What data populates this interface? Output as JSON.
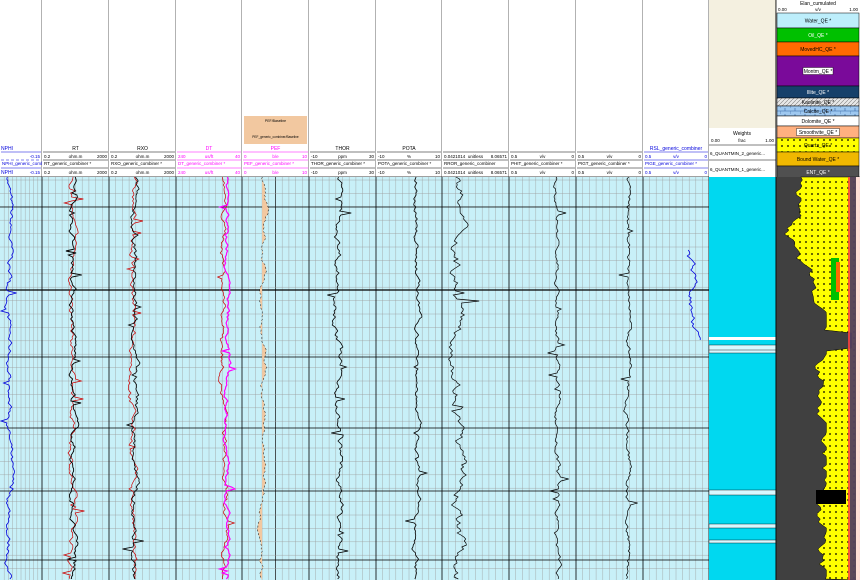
{
  "colors": {
    "plot_bg": "#c8f0f8",
    "grid_major": "#000000",
    "grid_minor": "#9a9a9a",
    "nphi": "#0000dd",
    "dt": "#ff00ff",
    "red_curve": "#cc0000",
    "pef_fill": "#f2c8a0",
    "sat_bg": "#00d8f0",
    "yellow": "#ffff00",
    "green": "#00c000",
    "orange": "#ff6a00",
    "purple": "#7a0a9a",
    "grey": "#404040",
    "navy": "#16406a",
    "pink": "#ff4040"
  },
  "tracks": [
    {
      "id": "nphi",
      "title": "",
      "cname": "NPHI_generic_combiner *",
      "unit": "",
      "left": "",
      "right": "-0.15",
      "color": "#0000dd",
      "name_top": "NPHI",
      "name_bottom": "NPHI"
    },
    {
      "id": "rt",
      "title": "RT",
      "cname": "RT_generic_combiner *",
      "unit": "ohm.m",
      "left": "0.2",
      "right": "2000",
      "color": "#000000",
      "name_top": "",
      "name_bottom": ""
    },
    {
      "id": "rxo",
      "title": "RXO",
      "cname": "RXO_generic_combiner *",
      "unit": "ohm.m",
      "left": "0.2",
      "right": "2000",
      "color": "#000000",
      "name_top": "",
      "name_bottom": ""
    },
    {
      "id": "dt",
      "title": "DT",
      "cname": "DT_generic_combiner *",
      "unit": "us/ft",
      "left": "240",
      "right": "40",
      "color": "#ff00ff",
      "name_top": "",
      "name_bottom": ""
    },
    {
      "id": "pef",
      "title": "PEF",
      "cname": "PEF_generic_combiner *",
      "unit": "b/e",
      "left": "0",
      "right": "10",
      "color": "#ff00ff",
      "name_top": "",
      "name_bottom": ""
    },
    {
      "id": "thor",
      "title": "THOR",
      "cname": "THOR_generic_combiner *",
      "unit": "ppm",
      "left": "-10",
      "right": "30",
      "color": "#000000",
      "name_top": "",
      "name_bottom": ""
    },
    {
      "id": "pota",
      "title": "POTA",
      "cname": "POTA_generic_combiner *",
      "unit": "%",
      "left": "-10",
      "right": "10",
      "color": "#000000",
      "name_top": "",
      "name_bottom": ""
    },
    {
      "id": "rror",
      "title": "",
      "cname": "RROR_generic_combiner",
      "unit": "unitless",
      "left": "0.0421014",
      "right": "8.06571",
      "color": "#000000",
      "name_top": "",
      "name_bottom": ""
    },
    {
      "id": "phit",
      "title": "",
      "cname": "PHIT_generic_combiner *",
      "unit": "v/v",
      "left": "0.5",
      "right": "0",
      "color": "#000000",
      "name_top": "",
      "name_bottom": ""
    },
    {
      "id": "pigt",
      "title": "",
      "cname": "PIGT_generic_combiner *",
      "unit": "v/v",
      "left": "0.5",
      "right": "0",
      "color": "#000000",
      "name_top": "",
      "name_bottom": ""
    },
    {
      "id": "pige",
      "title": "RSL_generic_combiner",
      "cname": "PIGE_generic_combiner *",
      "unit": "v/v",
      "left": "0.5",
      "right": "0",
      "color": "#0000dd",
      "name_top": "",
      "name_bottom": ""
    }
  ],
  "pef_legend": {
    "line1": "PEF/Baseline",
    "line2": "PEF_generic_combiner/Baseline"
  },
  "weights": {
    "title": "Weights",
    "left": "0.00",
    "unit": "frac",
    "right": "1.00"
  },
  "quantmin": [
    "6_QUANTMIN_2_generic...",
    "6_QUANTMIN_1_generic..."
  ],
  "elan": {
    "title": "Elan_cumulated",
    "left": "0.00",
    "unit": "v/v",
    "right": "1.00"
  },
  "legend": [
    {
      "label": "Water_QE *",
      "bg": "#bdeefb",
      "fg": "#000000",
      "sel": false
    },
    {
      "label": "Oil_QE *",
      "bg": "#00c000",
      "fg": "#ffffff",
      "sel": false
    },
    {
      "label": "MovedHC_QE *",
      "bg": "#ff6a00",
      "fg": "#000000",
      "sel": false
    },
    {
      "label": "Montm_QE *",
      "bg": "#7a0a9a",
      "fg": "#ffffff",
      "sel": true
    },
    {
      "label": "Illite_QE *",
      "bg": "#16406a",
      "fg": "#ffffff",
      "sel": false
    },
    {
      "label": "Kaolinite_QE *",
      "bg": "#b0b0b0",
      "fg": "#000000",
      "sel": false
    },
    {
      "label": "Calcite_QE *",
      "bg": "#9ec8f0",
      "fg": "#000000",
      "sel": false
    },
    {
      "label": "Dolomite_QE *",
      "bg": "#ffffff",
      "fg": "#000000",
      "sel": false
    },
    {
      "label": "Smoothvite_QE *",
      "bg": "#ffb080",
      "fg": "#000000",
      "sel": true
    },
    {
      "label": "Quartz_QE *",
      "bg": "#ffff00",
      "fg": "#000000",
      "sel": false
    },
    {
      "label": "Bound Water_QE *",
      "bg": "#f0b800",
      "fg": "#000000",
      "sel": false
    },
    {
      "label": "ENT_QE *",
      "bg": "#505050",
      "fg": "#ffffff",
      "sel": false
    }
  ]
}
